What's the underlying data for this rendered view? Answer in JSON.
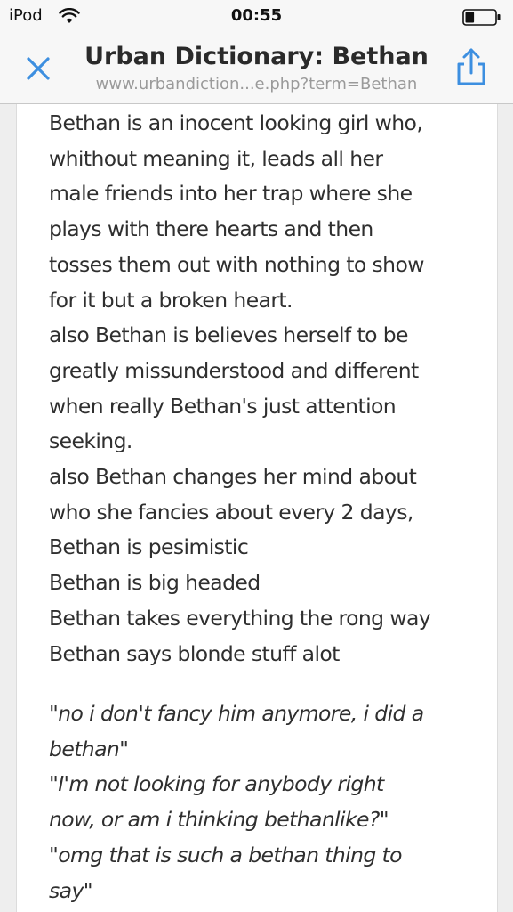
{
  "status_bar": {
    "carrier": "iPod",
    "time": "00:55",
    "wifi_icon": "wifi-icon",
    "battery_icon": "battery-icon",
    "battery_level": 0.3
  },
  "nav_bar": {
    "title": "Urban Dictionary: Bethan",
    "url": "www.urbandiction...e.php?term=Bethan",
    "close_icon": "close-icon",
    "share_icon": "share-icon",
    "accent_color": "#3d8fe0"
  },
  "definition": {
    "lines": [
      "Bethan is an inocent looking girl who,",
      "whithout meaning it, leads all her",
      "male friends into her trap where she",
      "plays with there hearts and then",
      "tosses them out with nothing to show",
      "for it but a broken heart.",
      "also Bethan is believes herself to be",
      "greatly missunderstood and different",
      "when really Bethan's just attention",
      "seeking.",
      "also Bethan changes her mind about",
      "who she fancies about every 2 days,",
      "Bethan is pesimistic",
      "Bethan is big headed",
      "Bethan takes everything the rong way",
      "Bethan says blonde stuff alot"
    ]
  },
  "example": {
    "lines": [
      "\"no i don't fancy him anymore, i did a",
      "bethan\"",
      "\"I'm not looking for anybody right",
      "now, or am i thinking bethanlike?\"",
      "\"omg that is such a bethan thing to",
      "say\""
    ]
  }
}
